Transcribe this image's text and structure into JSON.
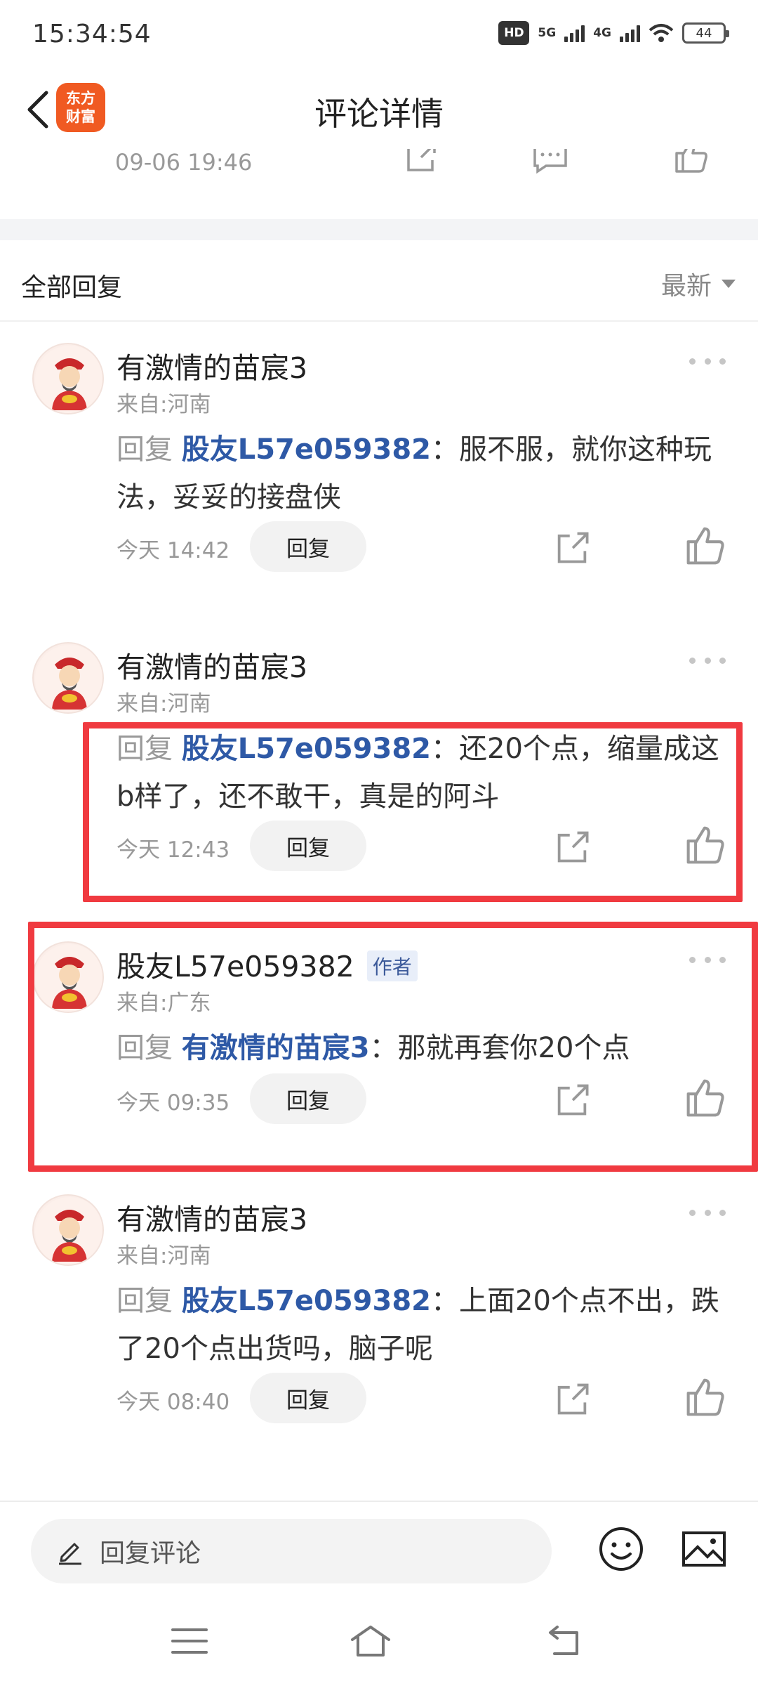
{
  "status_bar": {
    "time": "15:34:54",
    "network_1": "5G",
    "network_2": "4G",
    "battery": "44"
  },
  "header": {
    "title": "评论详情",
    "logo_line1": "东方",
    "logo_line2": "财富"
  },
  "previous_comment": {
    "time": "09-06 19:46"
  },
  "section": {
    "title": "全部回复",
    "sort_label": "最新"
  },
  "comments": [
    {
      "user": "有激情的苗宸3",
      "location": "来自:河南",
      "reply_prefix": "回复 ",
      "reply_to": "股友L57e059382",
      "text": "：服不服，就你这种玩法，妥妥的接盘侠",
      "time": "今天 14:42",
      "reply_label": "回复"
    },
    {
      "user": "有激情的苗宸3",
      "location": "来自:河南",
      "reply_prefix": "回复 ",
      "reply_to": "股友L57e059382",
      "text": "：还20个点，缩量成这b样了，还不敢干，真是的阿斗",
      "time": "今天 12:43",
      "reply_label": "回复"
    },
    {
      "user": "股友L57e059382",
      "author_badge": "作者",
      "location": "来自:广东",
      "reply_prefix": "回复 ",
      "reply_to": "有激情的苗宸3",
      "text": "：那就再套你20个点",
      "time": "今天 09:35",
      "reply_label": "回复"
    },
    {
      "user": "有激情的苗宸3",
      "location": "来自:河南",
      "reply_prefix": "回复 ",
      "reply_to": "股友L57e059382",
      "text": "：上面20个点不出，跌了20个点出货吗，脑子呢",
      "time": "今天 08:40",
      "reply_label": "回复"
    }
  ],
  "bottom_bar": {
    "reply_placeholder": "回复评论"
  },
  "colors": {
    "highlight": "#f03a40",
    "link": "#2e59a6",
    "brand": "#f05a22"
  }
}
